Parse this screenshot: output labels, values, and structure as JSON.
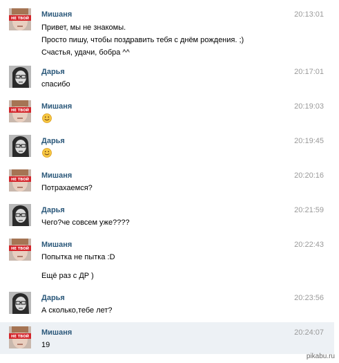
{
  "colors": {
    "author": "#2b587a",
    "time": "#999999",
    "highlight_row": "#edf1f5",
    "badge_red": "#d4242a"
  },
  "badge_text": "НЕ ТВОЙ",
  "watermark": "pikabu.ru",
  "messages": [
    {
      "author": "Мишаня",
      "time": "20:13:01",
      "lines": [
        "Привет, мы не знакомы.",
        "Просто пишу, чтобы поздравить тебя с днём рождения. ;)",
        "Счастья, удачи, бобра ^^"
      ]
    },
    {
      "author": "Дарья",
      "time": "20:17:01",
      "lines": [
        "спасибо"
      ]
    },
    {
      "author": "Мишаня",
      "time": "20:19:03",
      "emoji": "smile-emoji"
    },
    {
      "author": "Дарья",
      "time": "20:19:45",
      "emoji": "smile-emoji"
    },
    {
      "author": "Мишаня",
      "time": "20:20:16",
      "lines": [
        "Потрахаемся?"
      ]
    },
    {
      "author": "Дарья",
      "time": "20:21:59",
      "lines": [
        "Чего?че совсем уже????"
      ]
    },
    {
      "author": "Мишаня",
      "time": "20:22:43",
      "lines": [
        "Попытка не пытка :D",
        "Ещё раз с ДР )"
      ]
    },
    {
      "author": "Дарья",
      "time": "20:23:56",
      "lines": [
        "А сколько,тебе лет?"
      ]
    },
    {
      "author": "Мишаня",
      "time": "20:24:07",
      "lines": [
        "19"
      ]
    }
  ]
}
